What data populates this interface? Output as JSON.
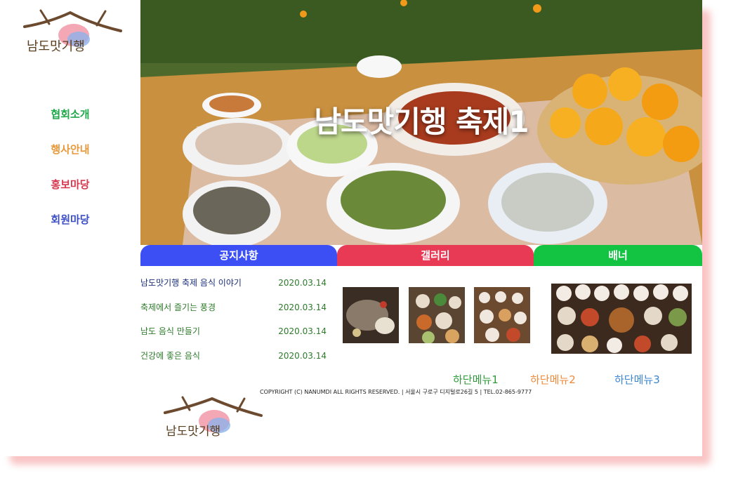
{
  "logo_text": "남도맛기행",
  "nav": {
    "items": [
      {
        "label": "협회소개",
        "color": "#1fa84a"
      },
      {
        "label": "행사안내",
        "color": "#e8993a"
      },
      {
        "label": "홍보마당",
        "color": "#d6394f"
      },
      {
        "label": "회원마당",
        "color": "#3d4fc4"
      }
    ]
  },
  "hero": {
    "title": "남도맛기행 축제1"
  },
  "tabs": [
    {
      "label": "공지사항",
      "color": "#3b4ff5"
    },
    {
      "label": "갤러리",
      "color": "#e83a55"
    },
    {
      "label": "배너",
      "color": "#12c441"
    }
  ],
  "notices": [
    {
      "title": "남도맛기행 축제 음식 이야기",
      "date": "2020.03.14"
    },
    {
      "title": "축제에서 즐기는 풍경",
      "date": "2020.03.14"
    },
    {
      "title": "남도 음식 만들기",
      "date": "2020.03.14"
    },
    {
      "title": "건강에 좋은 음식",
      "date": "2020.03.14"
    }
  ],
  "footer": {
    "menus": [
      {
        "label": "하단메뉴1",
        "color": "#2f9a3a"
      },
      {
        "label": "하단메뉴2",
        "color": "#ee8a3a"
      },
      {
        "label": "하단메뉴3",
        "color": "#3a86d0"
      }
    ],
    "copyright": "COPYRIGHT (C) NANUMDI ALL RIGHTS RESERVED. | 서울시 구로구 디지털로26길 5 | TEL.02-865-9777"
  }
}
